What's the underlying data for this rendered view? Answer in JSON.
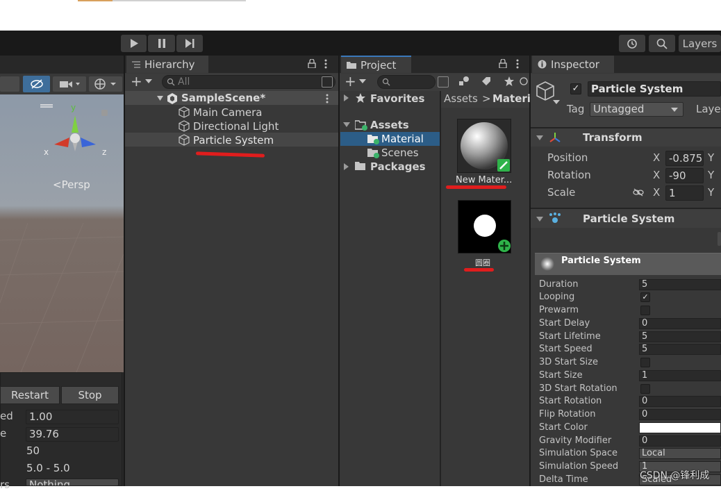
{
  "toolbar": {
    "play_icon": "play-icon",
    "pause_icon": "pause-icon",
    "step_icon": "step-icon",
    "history_icon": "history-icon",
    "search_icon": "search-icon",
    "layers_label": "Layers"
  },
  "scene": {
    "persp_label": "<Persp",
    "axis_y": "y",
    "axis_x": "x",
    "axis_z": "z",
    "effect_panel": {
      "restart": "Restart",
      "stop": "Stop",
      "rows": [
        {
          "label": "ed",
          "value": "1.00"
        },
        {
          "label": "e",
          "value": "39.76"
        },
        {
          "label": "",
          "value": "50"
        },
        {
          "label": "",
          "value": "5.0 - 5.0"
        },
        {
          "label": "rs",
          "value": "Nothing"
        }
      ]
    }
  },
  "hierarchy": {
    "tab": "Hierarchy",
    "search_placeholder": "All",
    "scene_name": "SampleScene*",
    "items": [
      "Main Camera",
      "Directional Light",
      "Particle System"
    ]
  },
  "project": {
    "tab": "Project",
    "favorites": "Favorites",
    "assets": "Assets",
    "material_folder": "Material",
    "scenes_folder": "Scenes",
    "packages": "Packages",
    "breadcrumb_root": "Assets",
    "breadcrumb_sep": ">",
    "breadcrumb_current": "Materi",
    "asset_items": [
      {
        "label": "New Mater..."
      },
      {
        "label": "圆圈"
      }
    ]
  },
  "inspector": {
    "tab": "Inspector",
    "object_name": "Particle System",
    "tag_label": "Tag",
    "tag_value": "Untagged",
    "layer_label": "Laye",
    "transform": {
      "title": "Transform",
      "position_label": "Position",
      "position_x": "-0.875",
      "rotation_label": "Rotation",
      "rotation_x": "-90",
      "scale_label": "Scale",
      "scale_x": "1",
      "x": "X",
      "y": "Y"
    },
    "particle_component": "Particle System",
    "particle_main": "Particle System",
    "rows": [
      {
        "label": "Duration",
        "value": "5"
      },
      {
        "label": "Looping",
        "value": "✓"
      },
      {
        "label": "Prewarm",
        "value": ""
      },
      {
        "label": "Start Delay",
        "value": "0"
      },
      {
        "label": "Start Lifetime",
        "value": "5"
      },
      {
        "label": "Start Speed",
        "value": "5"
      },
      {
        "label": "3D Start Size",
        "value": ""
      },
      {
        "label": "Start Size",
        "value": "1"
      },
      {
        "label": "3D Start Rotation",
        "value": ""
      },
      {
        "label": "Start Rotation",
        "value": "0"
      },
      {
        "label": "Flip Rotation",
        "value": "0"
      },
      {
        "label": "Start Color",
        "value": ""
      },
      {
        "label": "Gravity Modifier",
        "value": "0"
      },
      {
        "label": "Simulation Space",
        "value": "Local"
      },
      {
        "label": "Simulation Speed",
        "value": "1"
      },
      {
        "label": "Delta Time",
        "value": "Scaled"
      }
    ]
  },
  "watermark": "CSDN @锋利成",
  "colors": {
    "selection": "#2c5d87",
    "annotation": "#e01d1d"
  }
}
